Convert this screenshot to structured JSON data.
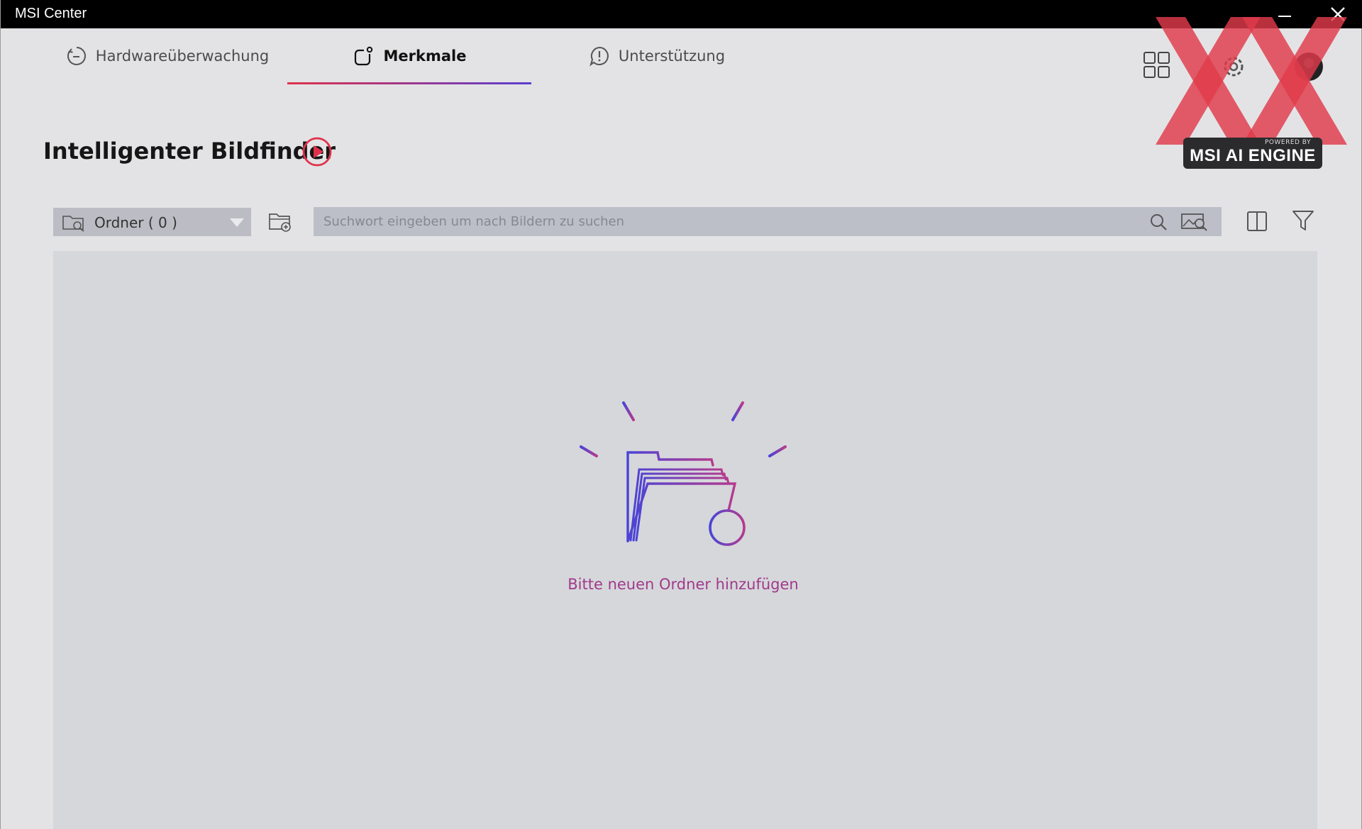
{
  "window": {
    "title": "MSI Center"
  },
  "tabs": [
    {
      "label": "Hardwareüberwachung",
      "icon": "gauge-icon",
      "active": false
    },
    {
      "label": "Merkmale",
      "icon": "features-icon",
      "active": true
    },
    {
      "label": "Unterstützung",
      "icon": "support-icon",
      "active": false
    }
  ],
  "header_icons": [
    "grid-icon",
    "gear-icon",
    "user-avatar-icon"
  ],
  "watermark": {
    "powered_by": "POWERED BY",
    "engine": "MSI AI ENGINE"
  },
  "page": {
    "title": "Intelligenter Bildfinder"
  },
  "toolbar": {
    "folder_select": "Ordner ( 0 )",
    "search_placeholder": "Suchwort eingeben um nach Bildern zu suchen"
  },
  "empty_state": {
    "message": "Bitte neuen Ordner hinzufügen"
  },
  "colors": {
    "accent_red": "#e0314b",
    "accent_purple": "#5a3fd0",
    "empty_text": "#a03a8a"
  }
}
